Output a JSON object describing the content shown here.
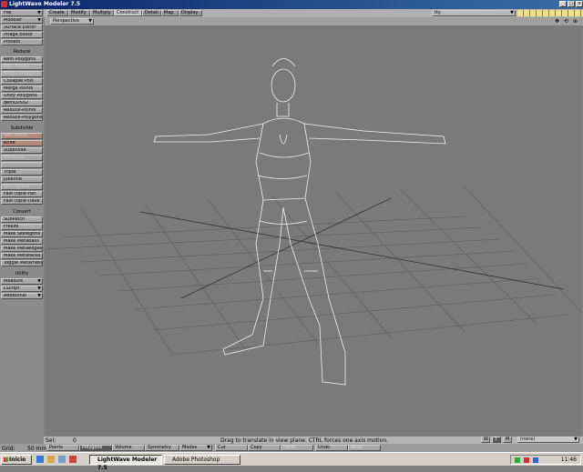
{
  "window": {
    "title": "LightWave Modeler 7.5"
  },
  "menu_tabs": [
    "Create",
    "Modify",
    "Multiply",
    "Construct",
    "Detail",
    "Map",
    "Display"
  ],
  "active_tab": "Construct",
  "layer_dropdown": "tty",
  "viewport": {
    "mode": "Perspective"
  },
  "sidebar": {
    "top": [
      "File",
      "Modeler",
      "Surface Editor",
      "Image Editor",
      "Presets"
    ],
    "sections": [
      {
        "header": "Reduce",
        "items": [
          "Rem Polygons",
          "Rem Points",
          "Merge Polygons",
          "Collapse Pols",
          "Merge Points",
          "Unify Polygons",
          "qemLOSS2",
          "Reduce-Points",
          "Reduce-Polygons"
        ]
      },
      {
        "header": "Subdivide",
        "items": [
          "Add Points",
          "Knife",
          "Subdivide",
          "BandSaw",
          "",
          "Triple",
          "Julienne",
          "Spin Quads",
          "Fast-Triple-Fan",
          "Fast-Triple-Trave"
        ]
      },
      {
        "header": "Convert",
        "items": [
          "SubPatch",
          "Freeze",
          "Make Skelegons",
          "Make Metaballs",
          "Make Metaedges",
          "Make Metafaces",
          "Toggle Metamesh"
        ]
      },
      {
        "header": "Utility",
        "items": [
          "Measure",
          "LScript",
          "Additional"
        ]
      }
    ]
  },
  "status": {
    "sel_label": "Sel:",
    "sel_value": "0",
    "message": "Drag to translate in view plane. CTRL forces one axis motion.",
    "w": "W",
    "t": "T",
    "m": "M",
    "surface": "(none)"
  },
  "bottom": {
    "grid_label": "Grid:",
    "grid_value": "50 mm",
    "buttons": [
      "Points",
      "Polygons",
      "Volume",
      "Symmetry",
      "Modes",
      "Cut",
      "Copy",
      "Paste",
      "Undo",
      "Redo"
    ],
    "selected": "Polygons"
  },
  "taskbar": {
    "start": "Início",
    "tasks": [
      "LightWave Modeler 7.5",
      "Adobe Photoshop"
    ],
    "time": "11:46"
  }
}
